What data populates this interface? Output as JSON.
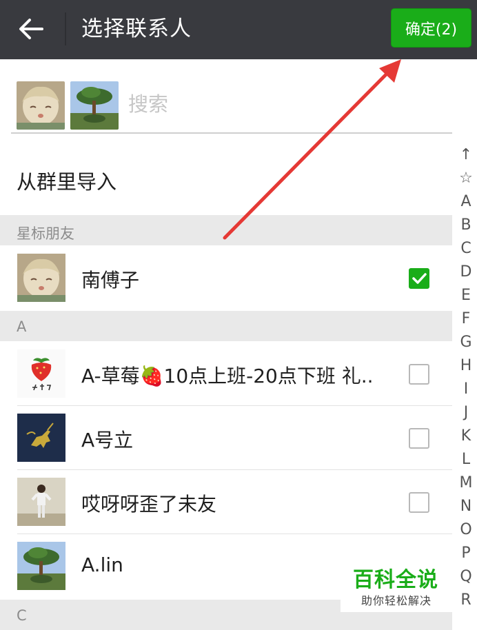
{
  "header": {
    "title": "选择联系人",
    "confirm_label": "确定(2)"
  },
  "search": {
    "placeholder": "搜索"
  },
  "import_label": "从群里导入",
  "sections": {
    "starred": "星标朋友",
    "a": "A",
    "c": "C"
  },
  "contacts": [
    {
      "name": "南傅子",
      "checked": true,
      "avatar": "anime-girl-avatar"
    },
    {
      "name": "A-草莓🍓10点上班-20点下班 礼..",
      "checked": false,
      "avatar": "strawberry-avatar"
    },
    {
      "name": "A号立",
      "checked": false,
      "avatar": "polo-horse-avatar"
    },
    {
      "name": "哎呀呀歪了未友",
      "checked": false,
      "avatar": "person-photo-avatar"
    },
    {
      "name": "A.lin",
      "checked": false,
      "avatar": "tree-photo-avatar"
    }
  ],
  "index_letters": [
    "↑",
    "☆",
    "A",
    "B",
    "C",
    "D",
    "E",
    "F",
    "G",
    "H",
    "I",
    "J",
    "K",
    "L",
    "M",
    "N",
    "O",
    "P",
    "Q",
    "R"
  ],
  "watermark": {
    "main": "百科全说",
    "sub": "助你轻松解决"
  },
  "colors": {
    "header_bg": "#393a3f",
    "accent_green": "#1aad19",
    "section_bg": "#e9e9e9",
    "arrow_red": "#e53935"
  }
}
